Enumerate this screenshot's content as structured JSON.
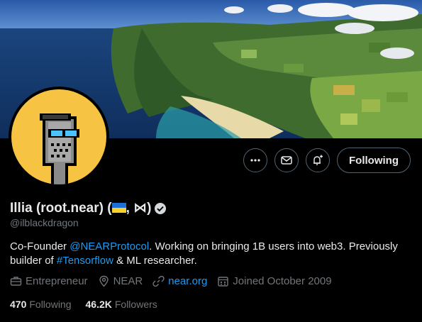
{
  "profile": {
    "display_name": "Illia (root.near) (",
    "name_suffix": ", ⋈)",
    "handle": "@ilblackdragon",
    "bio_prefix": "Co-Founder ",
    "bio_mention": "@NEARProtocol",
    "bio_middle": ". Working on bringing 1B users into web3. Previously builder of ",
    "bio_hashtag": "#Tensorflow",
    "bio_suffix": " & ML researcher.",
    "category": "Entrepreneur",
    "location": "NEAR",
    "website": "near.org",
    "joined": "Joined October 2009",
    "following_count": "470",
    "following_label": "Following",
    "followers_count": "46.2K",
    "followers_label": "Followers"
  },
  "actions": {
    "more_icon": "more-icon",
    "message_icon": "envelope-icon",
    "notify_icon": "bell-plus-icon",
    "follow_label": "Following"
  },
  "colors": {
    "background": "#000000",
    "link": "#1d9bf0",
    "secondary_text": "#71767b",
    "avatar_bg": "#f6c342"
  }
}
